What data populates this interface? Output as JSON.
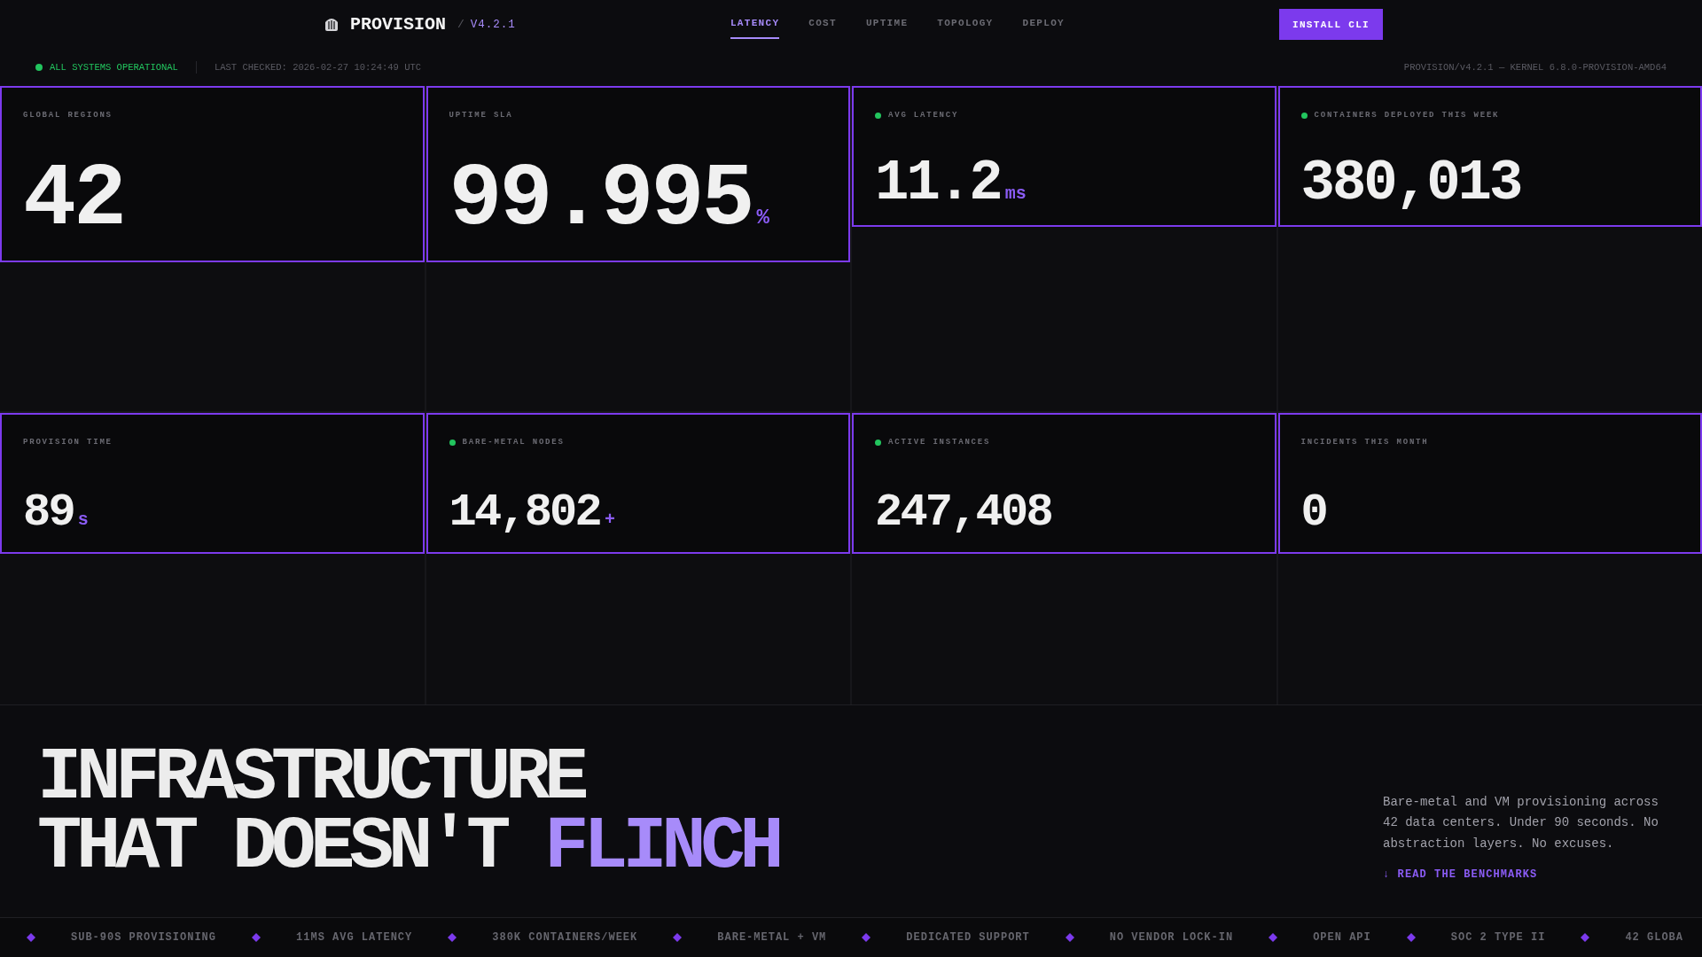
{
  "brand": {
    "name": "PROVISION",
    "separator": "/",
    "version": "V4.2.1"
  },
  "nav": {
    "tabs": [
      {
        "label": "LATENCY",
        "selected": true
      },
      {
        "label": "COST",
        "selected": false
      },
      {
        "label": "UPTIME",
        "selected": false
      },
      {
        "label": "TOPOLOGY",
        "selected": false
      },
      {
        "label": "DEPLOY",
        "selected": false
      }
    ],
    "cta": "INSTALL CLI"
  },
  "status_bar": {
    "status": {
      "label": "ALL SYSTEMS OPERATIONAL",
      "healthy": true
    },
    "last_checked": "LAST CHECKED: 2026-02-27 10:24:49 UTC",
    "build": "PROVISION/v4.2.1 — KERNEL 6.8.0-PROVISION-AMD64"
  },
  "metrics": [
    {
      "label": "GLOBAL REGIONS",
      "value": "42",
      "live": false,
      "kind": "hero"
    },
    {
      "label": "UPTIME SLA",
      "value": "99.995",
      "unit": "%",
      "live": false,
      "kind": "hero"
    },
    {
      "label": "AVG LATENCY",
      "value": "11.2",
      "unit": "ms",
      "live": true,
      "kind": "large"
    },
    {
      "label": "CONTAINERS DEPLOYED THIS WEEK",
      "value": "380,013",
      "live": true,
      "kind": "large"
    },
    {
      "label": "PROVISION TIME",
      "value": "89",
      "unit": "s",
      "live": false,
      "kind": "compact"
    },
    {
      "label": "BARE-METAL NODES",
      "value": "14,802",
      "unit": "+",
      "live": true,
      "kind": "compact"
    },
    {
      "label": "ACTIVE INSTANCES",
      "value": "247,408",
      "live": true,
      "kind": "compact"
    },
    {
      "label": "INCIDENTS THIS MONTH",
      "value": "0",
      "live": false,
      "kind": "compact"
    }
  ],
  "hero": {
    "headline": {
      "lines": [
        "INFRASTRUCTURE",
        "THAT DOESN'T"
      ],
      "accent": "FLINCH"
    },
    "description": "Bare-metal and VM provisioning across 42 data centers. Under 90 seconds. No abstraction layers. No excuses.",
    "link": "↓ READ THE BENCHMARKS"
  },
  "ticker": [
    "SUB-90S PROVISIONING",
    "11MS AVG LATENCY",
    "380K CONTAINERS/WEEK",
    "BARE-METAL + VM",
    "DEDICATED SUPPORT",
    "NO VENDOR LOCK-IN",
    "OPEN API",
    "SOC 2 TYPE II",
    "42 GLOBA"
  ]
}
